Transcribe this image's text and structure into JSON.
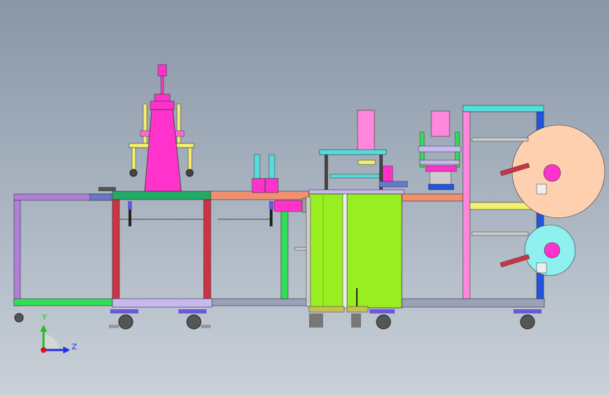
{
  "viewport": {
    "background_top": "#8996a7",
    "background_bottom": "#c9d0d8"
  },
  "triad": {
    "y_label": "Y",
    "z_label": "Z",
    "y_color": "#20c020",
    "z_color": "#2030e0",
    "origin_color": "#e01010"
  },
  "colors": {
    "frame_purple": "#b07fd8",
    "frame_red": "#cc3344",
    "frame_green": "#33dd55",
    "frame_lavender": "#c8b8f0",
    "frame_grey": "#9aa0b8",
    "top_plate_green": "#22aa66",
    "magenta": "#ff33cc",
    "pink": "#ff88dd",
    "lime": "#99ee22",
    "cyan": "#55dddd",
    "roll_peach": "#ffd0b0",
    "roll_cyan": "#8ff0f0",
    "salmon": "#ff9966",
    "blue": "#2255dd",
    "yellow": "#f5f070",
    "caster_purple": "#6a5ad8"
  }
}
